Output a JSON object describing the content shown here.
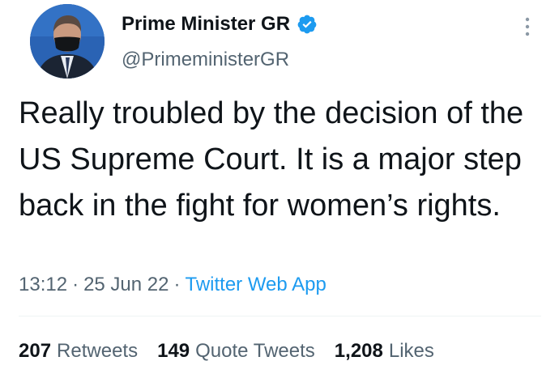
{
  "author": {
    "display_name": "Prime Minister GR",
    "handle": "@PrimeministerGR",
    "verified_icon": "verified-badge-icon",
    "accent_color": "#1d9bf0"
  },
  "tweet": {
    "text": "Really troubled by the decision of the US Supreme Court. It is a major step back in the fight for women’s rights.",
    "time": "13:12",
    "separator": "·",
    "date": "25 Jun 22",
    "source": "Twitter Web App"
  },
  "stats": {
    "retweets_count": "207",
    "retweets_label": "Retweets",
    "quote_tweets_count": "149",
    "quote_tweets_label": "Quote Tweets",
    "likes_count": "1,208",
    "likes_label": "Likes"
  }
}
